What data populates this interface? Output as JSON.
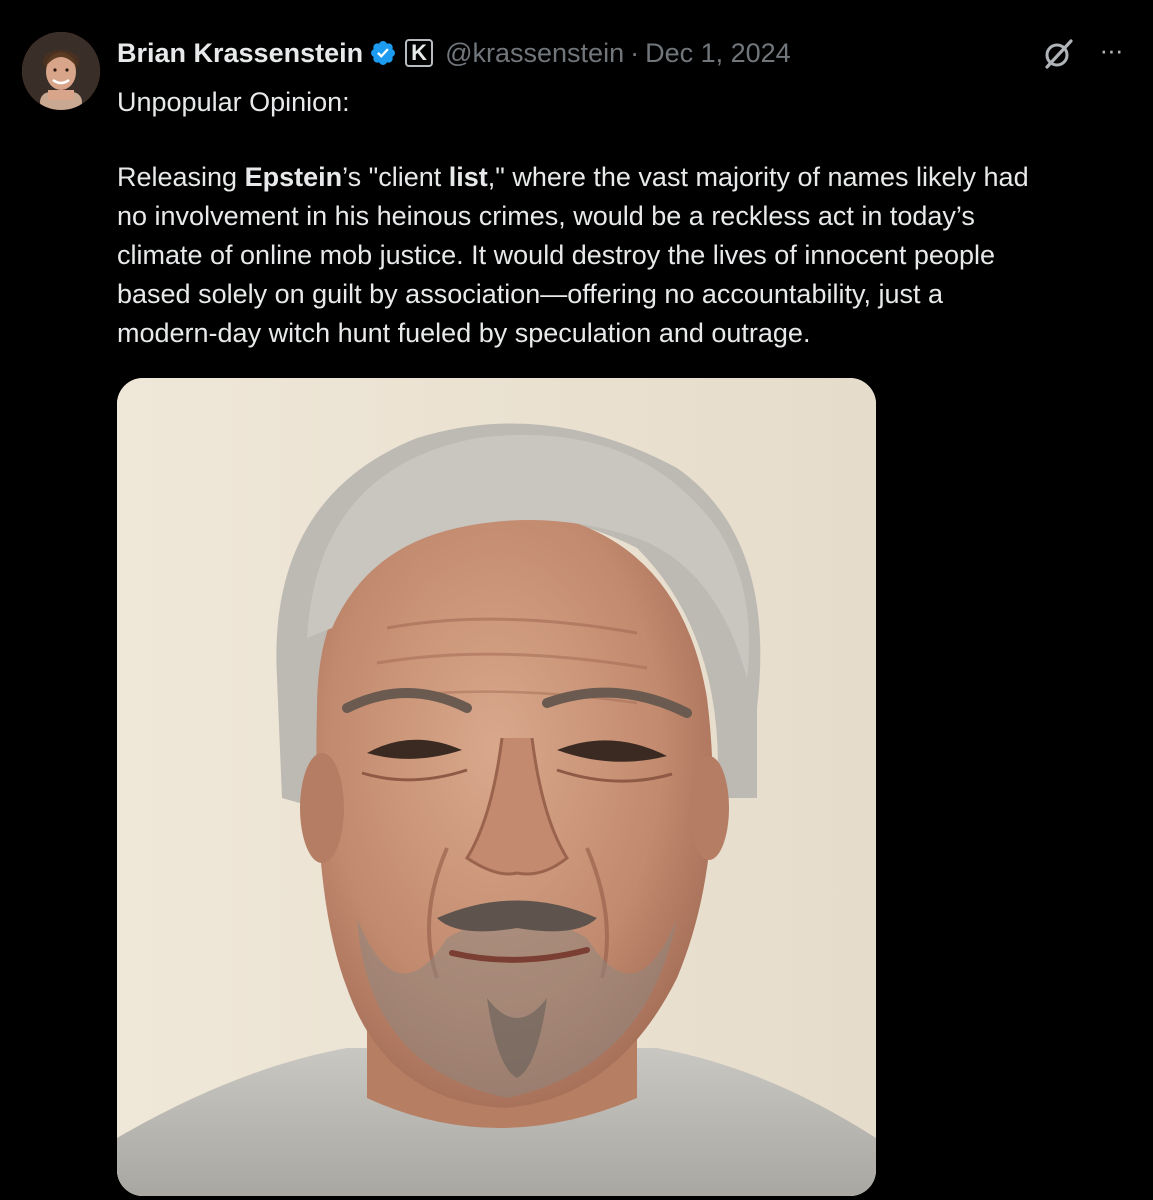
{
  "tweet": {
    "author": {
      "display_name": "Brian Krassenstein",
      "handle": "@krassenstein",
      "verified_icon": "verified-badge-icon",
      "affiliate_label": "K"
    },
    "separator": "·",
    "date": "Dec 1, 2024",
    "actions": {
      "grok_icon": "grok-icon",
      "more_label": "···"
    },
    "lead": "Unpopular Opinion:",
    "body": {
      "line1_pre": "Releasing ",
      "line1_bold1": "Epstein",
      "line1_mid": "’s \"client ",
      "line1_bold2": "list",
      "line1_post": ",\" where the vast majority of names likely had",
      "line2": "no involvement in his heinous crimes, would be a reckless act in today’s",
      "line3": "climate of online mob justice. It would destroy the lives of innocent people",
      "line4": "based solely on guilt by association—offering no accountability, just a",
      "line5": "modern-day witch hunt fueled by speculation and outrage."
    },
    "media": {
      "kind": "photo"
    }
  },
  "colors": {
    "background": "#000000",
    "primary_text": "#e7e9ea",
    "secondary_text": "#71767b",
    "verified_blue": "#1d9bf0"
  }
}
